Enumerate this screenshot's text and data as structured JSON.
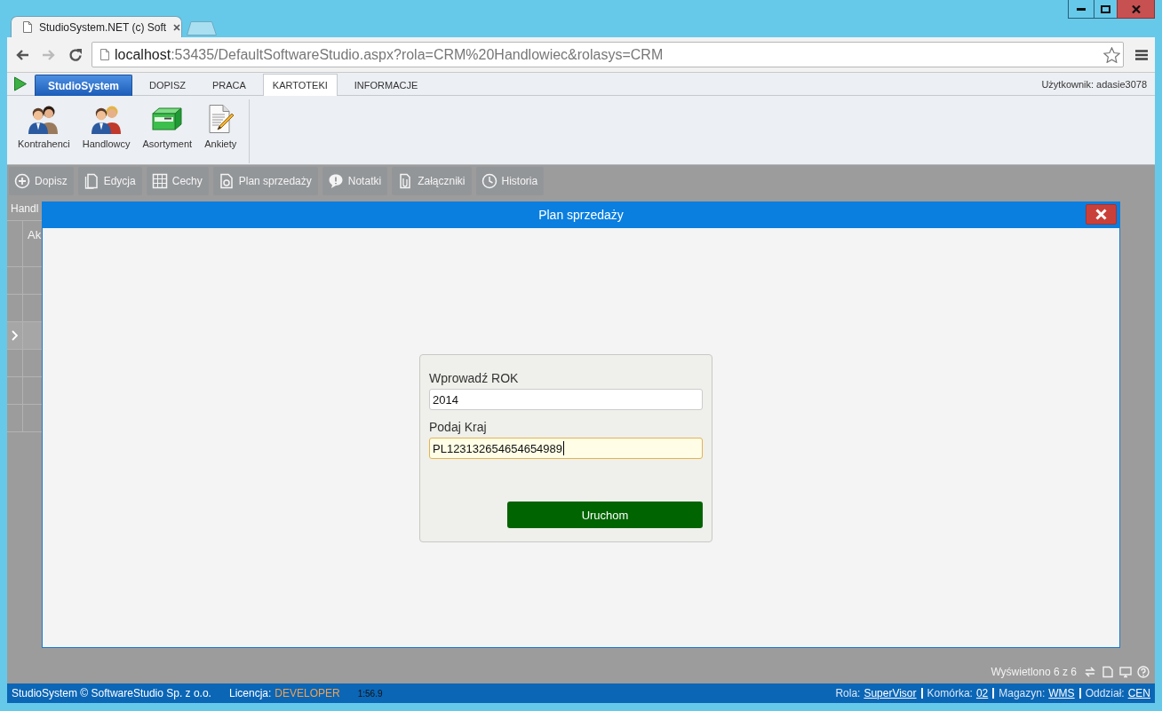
{
  "window": {
    "tab_title": "StudioSystem.NET (c) Soft",
    "url_host": "localhost",
    "url_path": ":53435/DefaultSoftwareStudio.aspx?rola=CRM%20Handlowiec&rolasys=CRM"
  },
  "menu": {
    "tabs": [
      {
        "label": "StudioSystem",
        "kind": "brand",
        "selected": false
      },
      {
        "label": "DOPISZ",
        "kind": "tab",
        "selected": false
      },
      {
        "label": "PRACA",
        "kind": "tab",
        "selected": false
      },
      {
        "label": "KARTOTEKI",
        "kind": "tab",
        "selected": true
      },
      {
        "label": "INFORMACJE",
        "kind": "tab",
        "selected": false
      }
    ],
    "user": "Użytkownik: adasie3078"
  },
  "ribbon": {
    "items": [
      {
        "label": "Kontrahenci"
      },
      {
        "label": "Handlowcy"
      },
      {
        "label": "Asortyment"
      },
      {
        "label": "Ankiety"
      }
    ]
  },
  "toolbar": {
    "buttons": [
      "Dopisz",
      "Edycja",
      "Cechy",
      "Plan sprzedaży",
      "Notatki",
      "Załączniki",
      "Historia"
    ]
  },
  "grid": {
    "caption": "Handl",
    "column_1": "Ak",
    "rows": [
      {
        "current": false
      },
      {
        "current": false
      },
      {
        "current": true
      },
      {
        "current": false
      },
      {
        "current": false
      },
      {
        "current": false
      }
    ],
    "summary": "Wyświetlono 6 z 6"
  },
  "dialog": {
    "title": "Plan sprzedaży",
    "fields": [
      {
        "label": "Wprowadź ROK",
        "value": "2014",
        "focused": false
      },
      {
        "label": "Podaj Kraj",
        "value": "PL123132654654654989",
        "focused": true
      }
    ],
    "submit": "Uruchom"
  },
  "status_bar": {
    "copyright": "StudioSystem © SoftwareStudio Sp. z o.o.",
    "license_label": "Licencja:",
    "license_value": "DEVELOPER",
    "timer": "1:56.9",
    "items": [
      {
        "label": "Rola:",
        "value": "SuperVisor"
      },
      {
        "label": "Komórka:",
        "value": "02"
      },
      {
        "label": "Magazyn:",
        "value": "WMS"
      },
      {
        "label": "Oddział:",
        "value": "CEN"
      }
    ]
  }
}
